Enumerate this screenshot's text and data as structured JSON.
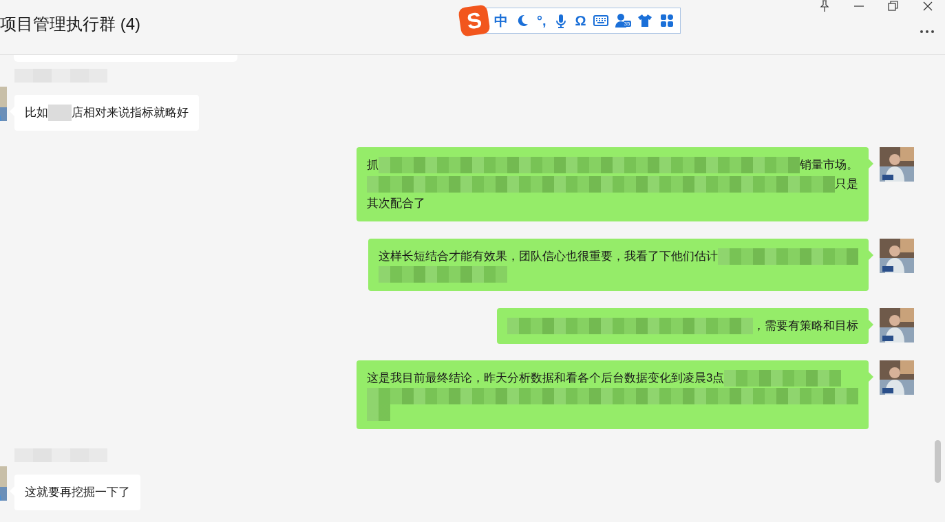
{
  "window": {
    "title": "项目管理执行群 (4)",
    "controls": [
      {
        "kind": "pin"
      },
      {
        "kind": "minimize"
      },
      {
        "kind": "restore"
      },
      {
        "kind": "close"
      }
    ],
    "more": {
      "kind": "more"
    }
  },
  "ime_toolbar": {
    "items": [
      {
        "kind": "logo",
        "text": "S"
      },
      {
        "kind": "text",
        "text": "中"
      },
      {
        "kind": "moon"
      },
      {
        "kind": "text",
        "text": "°,"
      },
      {
        "kind": "mic"
      },
      {
        "kind": "text",
        "text": "Ω"
      },
      {
        "kind": "keyboard"
      },
      {
        "kind": "user",
        "badge": "35"
      },
      {
        "kind": "shirt"
      },
      {
        "kind": "grid"
      }
    ]
  },
  "messages": [
    {
      "kind": "clipped"
    },
    {
      "kind": "received",
      "sender_redacted": true,
      "lines": [
        [
          {
            "kind": "text",
            "text": "比如"
          },
          {
            "kind": "redacted"
          },
          {
            "kind": "text",
            "text": "店相对来说指标就略好"
          }
        ]
      ]
    },
    {
      "kind": "sent",
      "lines": [
        [
          {
            "kind": "text",
            "text": "抓"
          },
          {
            "kind": "redacted"
          },
          {
            "kind": "text",
            "text": "销量市场。"
          }
        ],
        [
          {
            "kind": "redacted"
          },
          {
            "kind": "text",
            "text": "只是"
          }
        ],
        [
          {
            "kind": "text",
            "text": "其次配合了"
          }
        ]
      ]
    },
    {
      "kind": "sent",
      "lines": [
        [
          {
            "kind": "text",
            "text": "这样长短结合才能有效果，团队信心也很重要，我看了下他们估计"
          },
          {
            "kind": "redacted"
          }
        ],
        [
          {
            "kind": "redacted"
          }
        ]
      ]
    },
    {
      "kind": "sent",
      "lines": [
        [
          {
            "kind": "redacted"
          },
          {
            "kind": "text",
            "text": "，需要有策略和目标"
          }
        ]
      ]
    },
    {
      "kind": "sent",
      "lines": [
        [
          {
            "kind": "text",
            "text": "这是我目前最终结论，昨天分析数据和看各个后台数据变化到凌晨3点"
          },
          {
            "kind": "redacted"
          }
        ],
        [
          {
            "kind": "redacted"
          }
        ],
        [
          {
            "kind": "redacted"
          }
        ]
      ]
    },
    {
      "kind": "received",
      "sender_redacted": true,
      "lines": [
        [
          {
            "kind": "text",
            "text": "这就要再挖掘一下了"
          }
        ]
      ]
    }
  ]
}
